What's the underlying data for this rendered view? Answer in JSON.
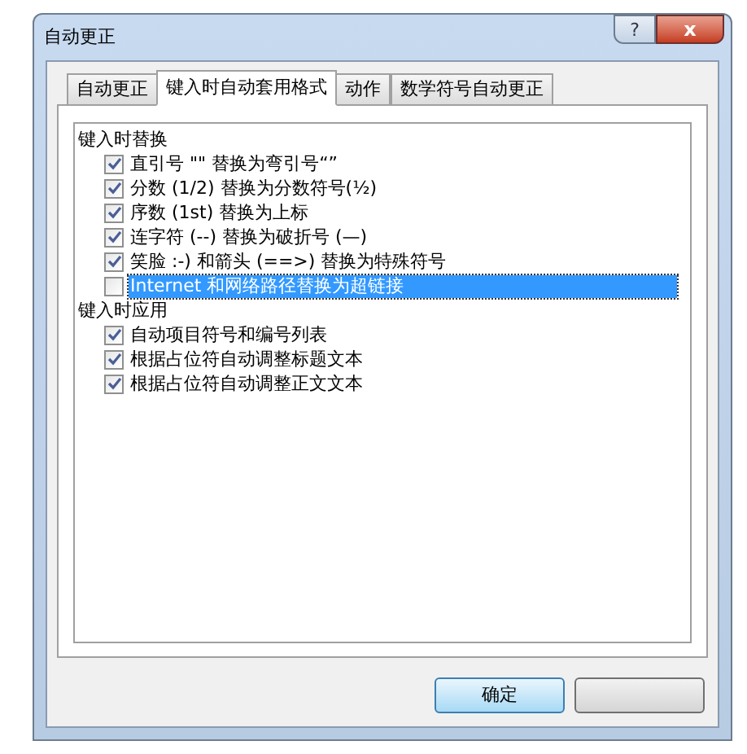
{
  "window": {
    "title": "自动更正",
    "help_button": "?",
    "close_button": "x"
  },
  "tabs": [
    {
      "label": "自动更正",
      "selected": false
    },
    {
      "label": "键入时自动套用格式",
      "selected": true
    },
    {
      "label": "动作",
      "selected": false
    },
    {
      "label": "数学符号自动更正",
      "selected": false
    }
  ],
  "list": [
    {
      "kind": "header",
      "label": "键入时替换"
    },
    {
      "kind": "option",
      "label": "直引号 \"\" 替换为弯引号“”",
      "checked": true,
      "selected": false
    },
    {
      "kind": "option",
      "label": "分数 (1/2) 替换为分数符号(½)",
      "checked": true,
      "selected": false
    },
    {
      "kind": "option",
      "label": "序数 (1st) 替换为上标",
      "checked": true,
      "selected": false
    },
    {
      "kind": "option",
      "label": "连字符 (--) 替换为破折号 (—)",
      "checked": true,
      "selected": false
    },
    {
      "kind": "option",
      "label": "笑脸 :-) 和箭头 (==>) 替换为特殊符号",
      "checked": true,
      "selected": false
    },
    {
      "kind": "option",
      "label": "Internet 和网络路径替换为超链接",
      "checked": false,
      "selected": true
    },
    {
      "kind": "header",
      "label": "键入时应用"
    },
    {
      "kind": "option",
      "label": "自动项目符号和编号列表",
      "checked": true,
      "selected": false
    },
    {
      "kind": "option",
      "label": "根据占位符自动调整标题文本",
      "checked": true,
      "selected": false
    },
    {
      "kind": "option",
      "label": "根据占位符自动调整正文文本",
      "checked": true,
      "selected": false
    }
  ],
  "buttons": [
    {
      "kind": "ok",
      "label": "确定"
    },
    {
      "kind": "cancel"
    }
  ]
}
